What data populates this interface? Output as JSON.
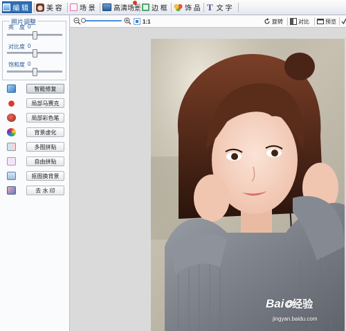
{
  "toolbar": {
    "tabs": [
      {
        "label": "编 辑",
        "icon": "edit-icon",
        "active": true
      },
      {
        "label": "美 容",
        "icon": "face-icon"
      },
      {
        "label": "场 景",
        "icon": "scene-icon"
      },
      {
        "label": "高清场景",
        "icon": "hd-scene-icon"
      },
      {
        "label": "边 框",
        "icon": "frame-icon"
      },
      {
        "label": "饰 品",
        "icon": "ornament-icon"
      },
      {
        "label": "文 字",
        "icon": "text-icon"
      }
    ]
  },
  "adjust": {
    "title": "照片调整",
    "sliders": [
      {
        "label": "亮　度",
        "value": "0",
        "level": 0.5
      },
      {
        "label": "对比度",
        "value": "0",
        "level": 0.5
      },
      {
        "label": "饱和度",
        "value": "0",
        "level": 0.5
      }
    ]
  },
  "tools": [
    {
      "label": "智能修复",
      "icon": "smart-fix-icon",
      "selected": true
    },
    {
      "label": "局部马赛克",
      "icon": "mosaic-heart-icon"
    },
    {
      "label": "局部彩色笔",
      "icon": "color-pen-icon"
    },
    {
      "label": "背景虚化",
      "icon": "blur-background-icon"
    },
    {
      "label": "多图拼贴",
      "icon": "multi-collage-icon"
    },
    {
      "label": "自由拼贴",
      "icon": "free-collage-icon"
    },
    {
      "label": "抠图换背景",
      "icon": "cutout-icon"
    },
    {
      "label": "去 水 印",
      "icon": "remove-watermark-icon"
    }
  ],
  "viewbar": {
    "zoom_ratio": "1:1",
    "rotate": "旋转",
    "compare": "对比",
    "preview": "预览"
  },
  "watermark": {
    "brand": "Bai",
    "brand_cn": "经验",
    "url": "jingyan.baidu.com"
  },
  "colors": {
    "accent": "#2f6fb6",
    "panel": "#fafbfc",
    "canvas": "#dadada",
    "sweater": "#7c8089",
    "hair": "#3a1d12"
  }
}
